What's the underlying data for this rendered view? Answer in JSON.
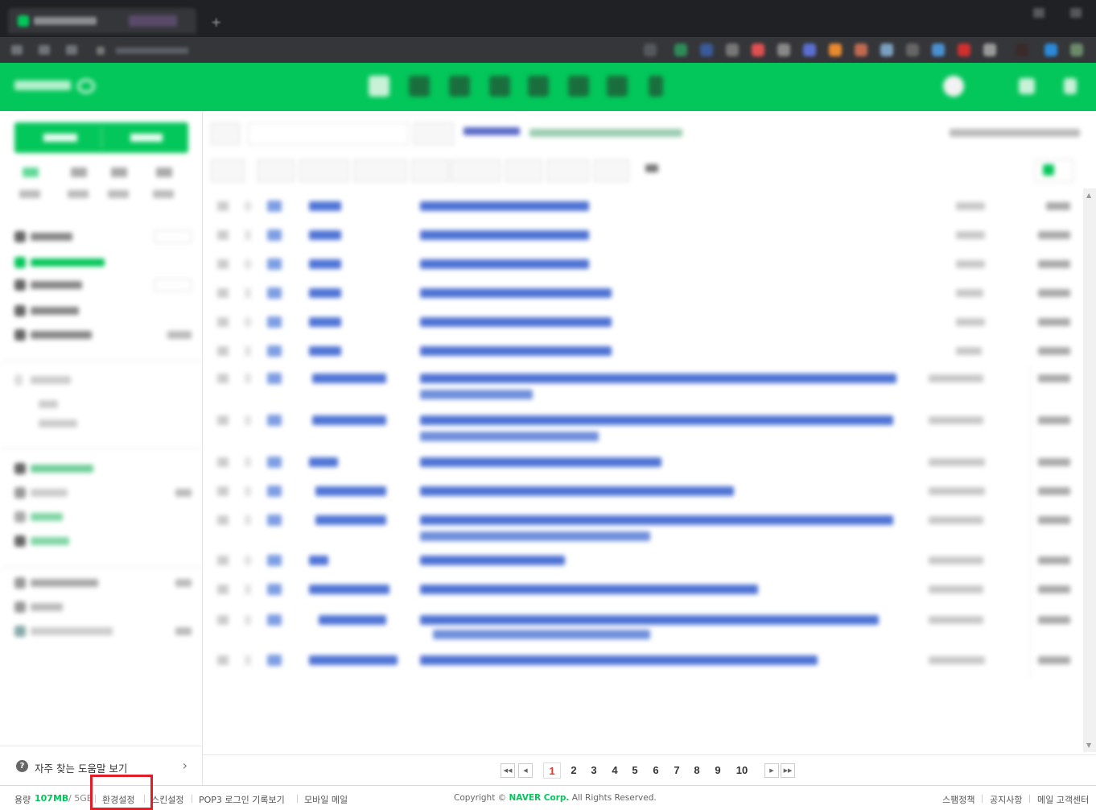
{
  "sidebar": {
    "help_label": "자주 찾는 도움말 보기"
  },
  "pagination": {
    "current": "1",
    "pages": [
      "2",
      "3",
      "4",
      "5",
      "6",
      "7",
      "8",
      "9",
      "10"
    ]
  },
  "footer": {
    "usage_label": "용량",
    "usage_used": "107MB",
    "usage_total": "/ 5GB",
    "links": [
      "환경설정",
      "스킨설정",
      "POP3 로그인 기록보기",
      "모바일 메일"
    ],
    "copyright_prefix": "Copyright ©",
    "copyright_brand": "NAVER Corp.",
    "copyright_suffix": "All Rights Reserved.",
    "right_links": [
      "스팸정책",
      "공지사항",
      "메일 고객센터"
    ]
  },
  "highlight": {
    "target": "환경설정",
    "color": "#e21d25"
  },
  "colors": {
    "brand": "#03c75a",
    "current_page": "#e5362b"
  }
}
